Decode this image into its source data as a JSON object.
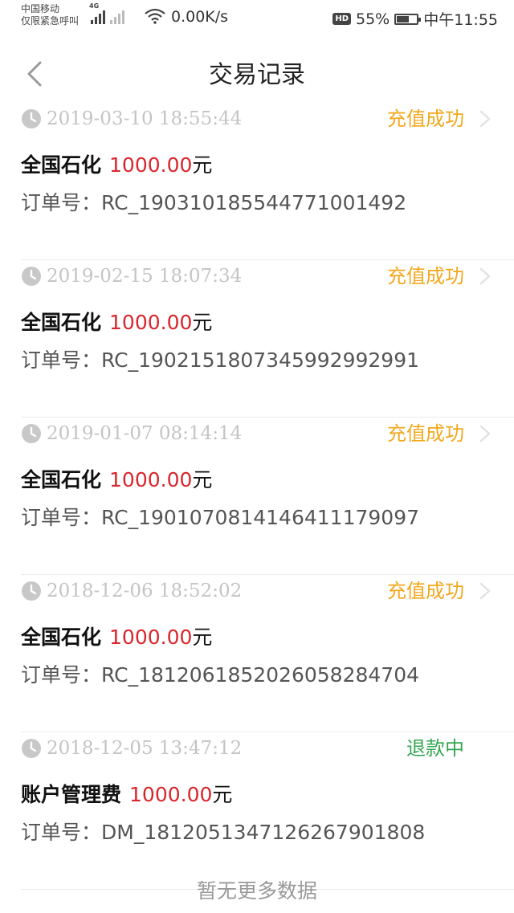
{
  "status_bar": {
    "carrier_line1": "中国移动",
    "carrier_line2": "仅限紧急呼叫",
    "net_tag": "4G",
    "net_speed": "0.00K/s",
    "hd": "HD",
    "battery": "55%",
    "time": "中午11:55"
  },
  "header": {
    "title": "交易记录",
    "back_icon": "chevron-left-icon"
  },
  "labels": {
    "order_prefix": "订单号：",
    "unit": "元"
  },
  "colors": {
    "success": "#f2a81d",
    "refund": "#33a651",
    "amount": "#d9262c"
  },
  "records": [
    {
      "time": "2019-03-10 18:55:44",
      "status": "充值成功",
      "status_type": "success",
      "merchant": "全国石化",
      "amount": "1000.00",
      "order": "RC_190310185544771001492"
    },
    {
      "time": "2019-02-15 18:07:34",
      "status": "充值成功",
      "status_type": "success",
      "merchant": "全国石化",
      "amount": "1000.00",
      "order": "RC_190215180734599299299 1"
    },
    {
      "time": "2019-01-07 08:14:14",
      "status": "充值成功",
      "status_type": "success",
      "merchant": "全国石化",
      "amount": "1000.00",
      "order": "RC_190107081414641117909 7"
    },
    {
      "time": "2018-12-06 18:52:02",
      "status": "充值成功",
      "status_type": "success",
      "merchant": "全国石化",
      "amount": "1000.00",
      "order": "RC_181206185202605828470 4"
    },
    {
      "time": "2018-12-05 13:47:12",
      "status": "退款中",
      "status_type": "refund",
      "merchant": "账户管理费",
      "amount": "1000.00",
      "order": "DM_181205134712626790180 8"
    }
  ],
  "footer": "暂无更多数据"
}
